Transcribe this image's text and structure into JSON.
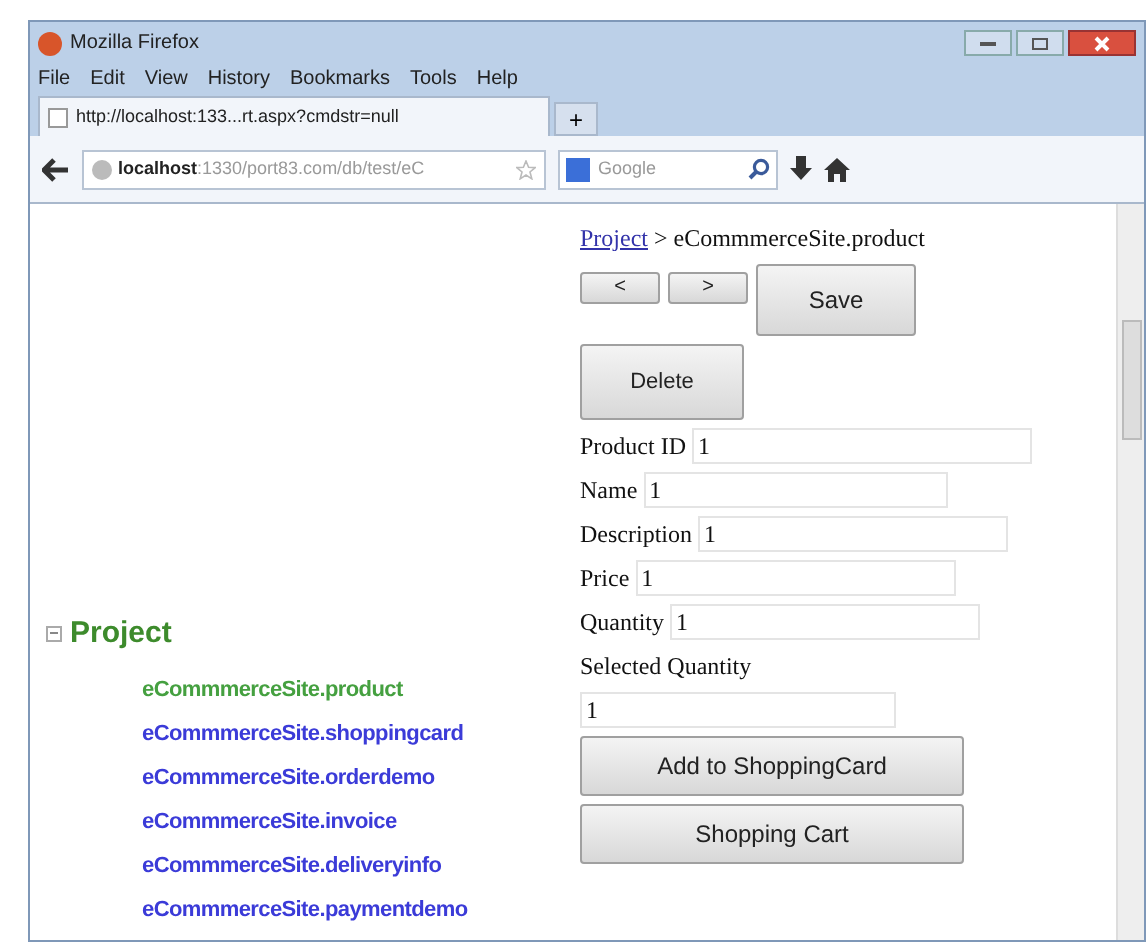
{
  "window": {
    "title": "Mozilla Firefox"
  },
  "menu": [
    "File",
    "Edit",
    "View",
    "History",
    "Bookmarks",
    "Tools",
    "Help"
  ],
  "tab": {
    "title": "http://localhost:133...rt.aspx?cmdstr=null",
    "new_tab": "+"
  },
  "address": {
    "host": "localhost",
    "rest": ":1330/port83.com/db/test/eC"
  },
  "search": {
    "placeholder": "Google"
  },
  "tree": {
    "title": "Project",
    "expanded": true,
    "children": [
      {
        "label": "eCommmerceSite.product",
        "selected": true
      },
      {
        "label": "eCommmerceSite.shoppingcard",
        "selected": false
      },
      {
        "label": "eCommmerceSite.orderdemo",
        "selected": false
      },
      {
        "label": "eCommmerceSite.invoice",
        "selected": false
      },
      {
        "label": "eCommmerceSite.deliveryinfo",
        "selected": false
      },
      {
        "label": "eCommmerceSite.paymentdemo",
        "selected": false
      }
    ]
  },
  "breadcrumb": {
    "link": "Project",
    "rest": " > eCommmerceSite.product"
  },
  "nav_buttons": [
    "<",
    ">"
  ],
  "save": "Save",
  "delete": "Delete",
  "fields": [
    {
      "label": "Product ID",
      "value": "1"
    },
    {
      "label": "Name",
      "value": "1"
    },
    {
      "label": "Description",
      "value": "1"
    },
    {
      "label": "Price",
      "value": "1"
    },
    {
      "label": "Quantity",
      "value": "1"
    }
  ],
  "selected_quantity": {
    "label": "Selected Quantity",
    "value": "1"
  },
  "actions": [
    "Add to ShoppingCard",
    "Shopping Cart"
  ]
}
